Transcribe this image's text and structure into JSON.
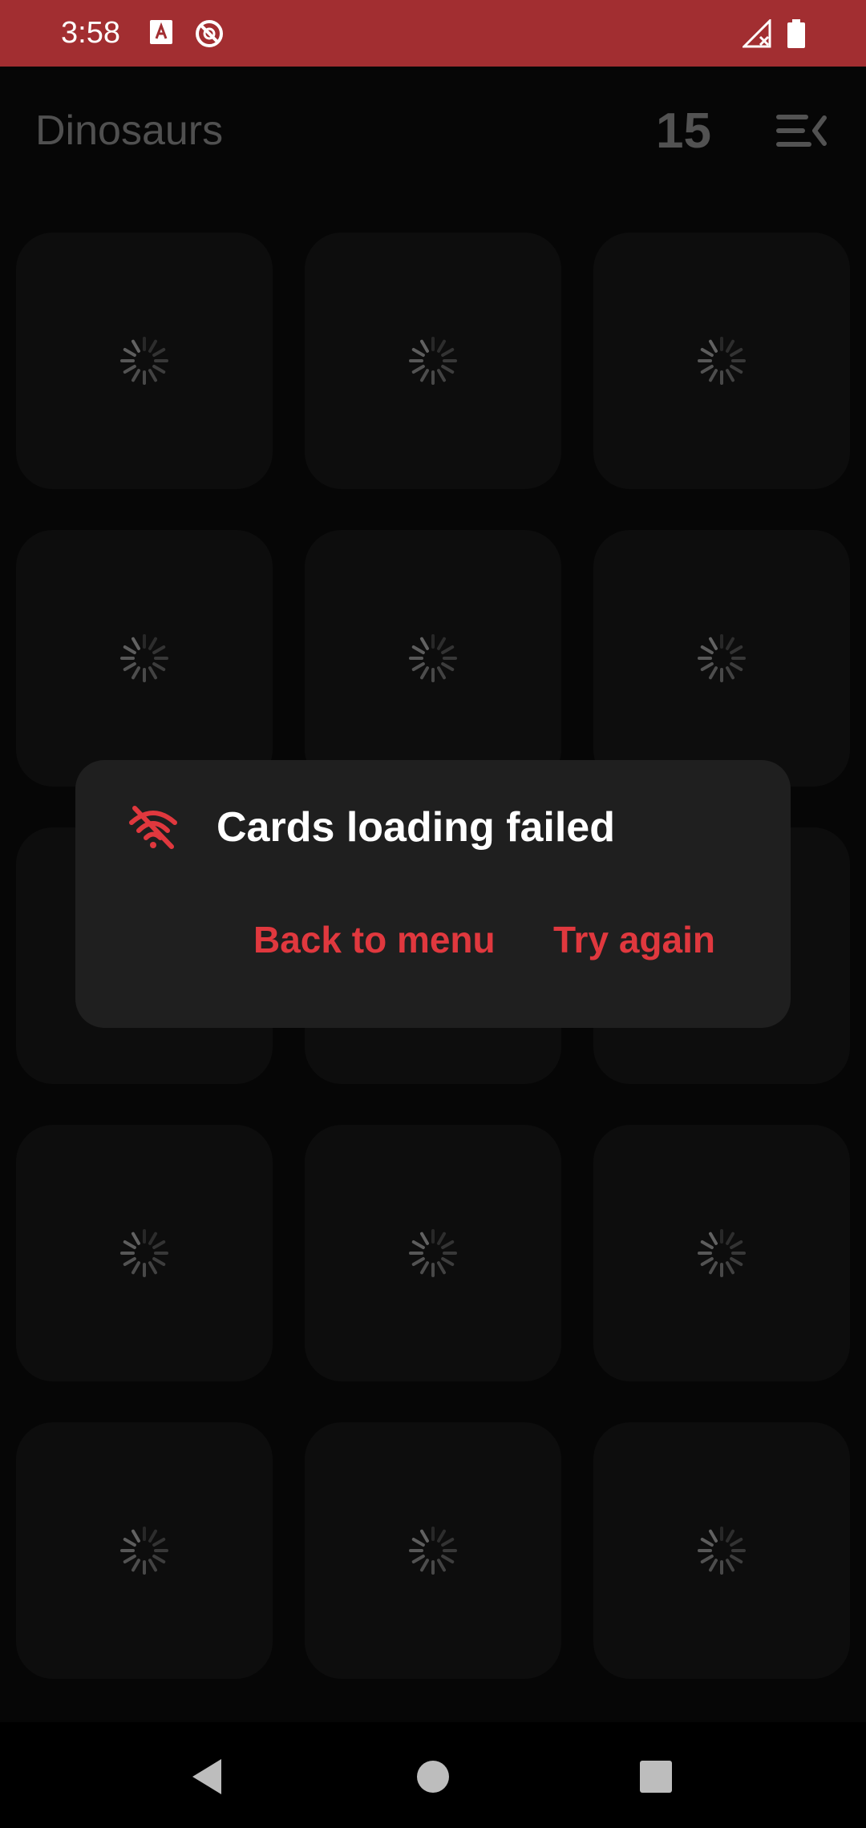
{
  "status_bar": {
    "time": "3:58",
    "left_icons": [
      "text-recognition-icon",
      "no-disturb-icon"
    ],
    "right_icons": [
      "cellular-signal-icon",
      "battery-icon"
    ],
    "background": "#a22e31"
  },
  "app_bar": {
    "title": "Dinosaurs",
    "counter": "15",
    "menu_icon": "menu-collapse-icon"
  },
  "grid": {
    "columns": 3,
    "rows": 5,
    "card_count": 15,
    "card_state": "loading",
    "card_icon": "loading-spinner-icon",
    "card_color": "#171717"
  },
  "dialog": {
    "icon": "wifi-off-icon",
    "title": "Cards loading failed",
    "buttons": {
      "back": "Back to menu",
      "retry": "Try again"
    },
    "accent_color": "#e0383e"
  },
  "nav_bar": {
    "icons": [
      "back-icon",
      "home-icon",
      "recents-icon"
    ]
  }
}
